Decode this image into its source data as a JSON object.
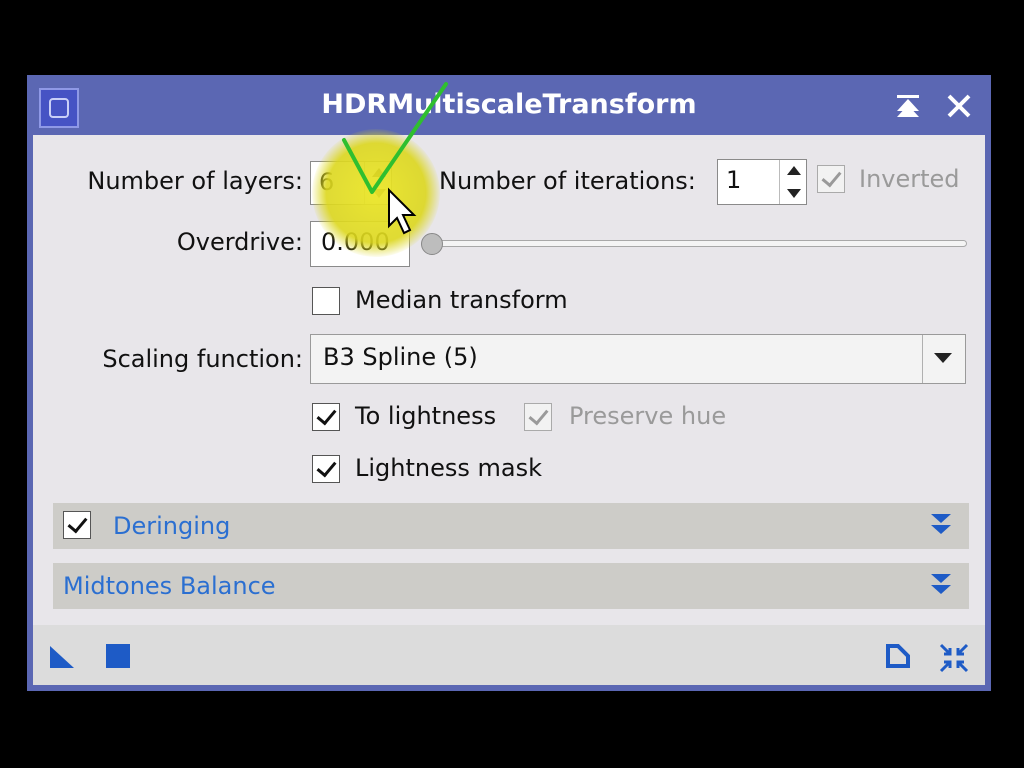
{
  "window": {
    "title": "HDRMultiscaleTransform"
  },
  "params": {
    "layers_label": "Number of layers:",
    "layers_value": "6",
    "iterations_label": "Number of iterations:",
    "iterations_value": "1",
    "inverted_label": "Inverted",
    "overdrive_label": "Overdrive:",
    "overdrive_value": "0.000",
    "median_label": "Median transform",
    "scaling_label": "Scaling function:",
    "scaling_value": "B3 Spline (5)",
    "to_lightness_label": "To lightness",
    "preserve_hue_label": "Preserve hue",
    "lightness_mask_label": "Lightness mask"
  },
  "sections": {
    "deringing": "Deringing",
    "midtones": "Midtones Balance"
  },
  "colors": {
    "titlebar": "#5b67b3",
    "section_title": "#2b6fd1",
    "icon_blue": "#1e5bc6",
    "highlight": "#ebe628",
    "check_overlay": "#2fbf2f"
  },
  "icons": [
    "app-icon",
    "collapse-icon",
    "close-icon",
    "new-instance-icon",
    "apply-global-icon",
    "preview-icon",
    "reset-icon",
    "cursor-icon"
  ]
}
